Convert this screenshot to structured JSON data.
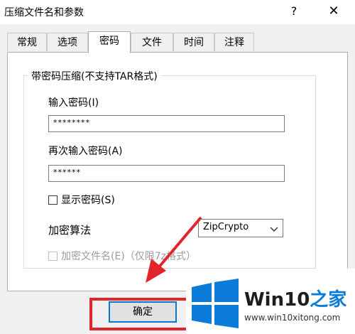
{
  "window": {
    "title": "压缩文件名和参数",
    "help_glyph": "?",
    "close_glyph": "✕"
  },
  "tabs": [
    {
      "label": "常规"
    },
    {
      "label": "选项"
    },
    {
      "label": "密码",
      "active": true
    },
    {
      "label": "文件"
    },
    {
      "label": "时间"
    },
    {
      "label": "注释"
    }
  ],
  "password_group": {
    "title": "带密码压缩(不支持TAR格式)",
    "enter_label": "输入密码(I)",
    "enter_value": "********",
    "reenter_label": "再次输入密码(A)",
    "reenter_value": "******",
    "show_password_label": "显示密码(S)",
    "algorithm_label": "加密算法",
    "algorithm_value": "ZipCrypto",
    "encrypt_names_label": "加密文件名(E)（仅限7z格式）"
  },
  "buttons": {
    "ok": "确定"
  },
  "watermark": {
    "brand_a": "Win10",
    "brand_b": "之家",
    "url": "www.win10xitong.com"
  },
  "colors": {
    "highlight": "#e0262a",
    "accent": "#0078d7",
    "brand_blue": "#0a7bd8"
  }
}
